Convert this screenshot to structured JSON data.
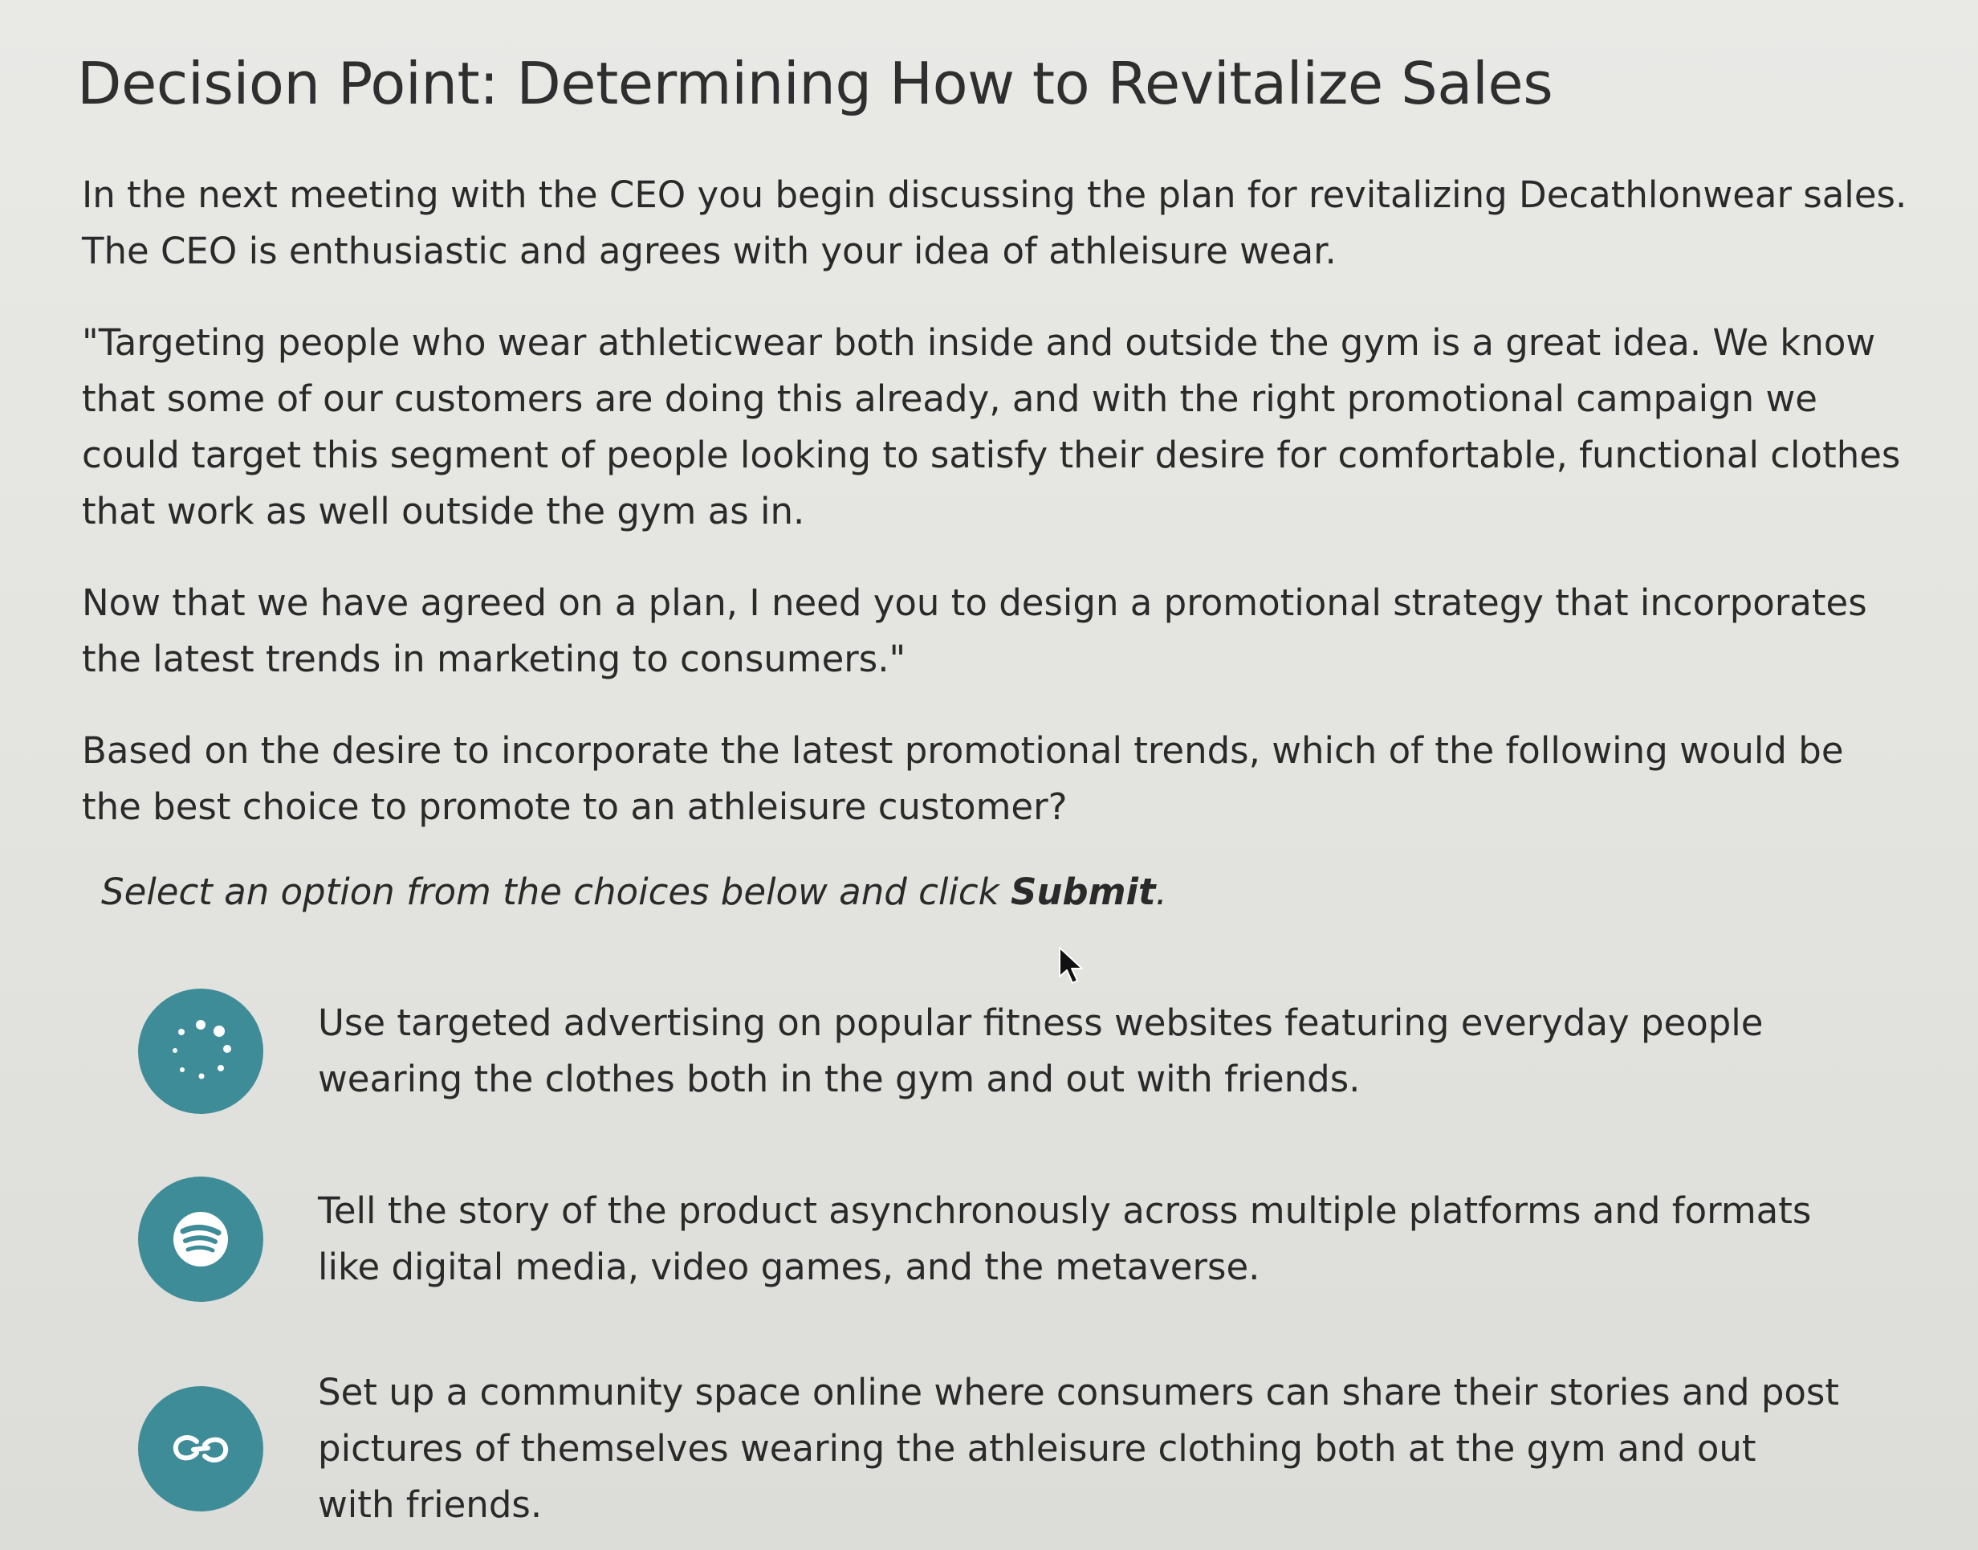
{
  "title": "Decision Point: Determining How to Revitalize Sales",
  "paragraphs": [
    "In the next meeting with the CEO you begin discussing the plan for revitalizing Decathlonwear sales. The CEO is enthusiastic and agrees with your idea of athleisure wear.",
    "\"Targeting people who wear athleticwear both inside and outside the gym is a great idea. We know that some of our customers are doing this already, and with the right promotional campaign we could target this segment of people looking to satisfy their desire for comfortable, functional clothes that work as well outside the gym as in.",
    "Now that we have agreed on a plan, I need you to design a promotional strategy that incorporates the latest trends in marketing to consumers.\"",
    "Based on the desire to incorporate the latest promotional trends, which of the following would be the best choice to promote to an athleisure customer?"
  ],
  "instruction": {
    "prefix": "Select an option from the choices below and click ",
    "action": "Submit",
    "suffix": "."
  },
  "options": [
    {
      "icon": "dots-circle-icon",
      "text": "Use targeted advertising on popular fitness websites featuring everyday people wearing the clothes both in the gym and out with friends."
    },
    {
      "icon": "broadcast-lines-icon",
      "text": "Tell the story of the product asynchronously across multiple platforms and formats like digital media, video games, and the metaverse."
    },
    {
      "icon": "link-icon",
      "text": "Set up a community space online where consumers can share their stories and post pictures of themselves wearing the athleisure clothing both at the gym and out with friends."
    }
  ],
  "colors": {
    "icon_background": "#3f8c99",
    "icon_foreground": "#ffffff",
    "text": "#2a2a2a",
    "background": "#e6e6e2"
  }
}
